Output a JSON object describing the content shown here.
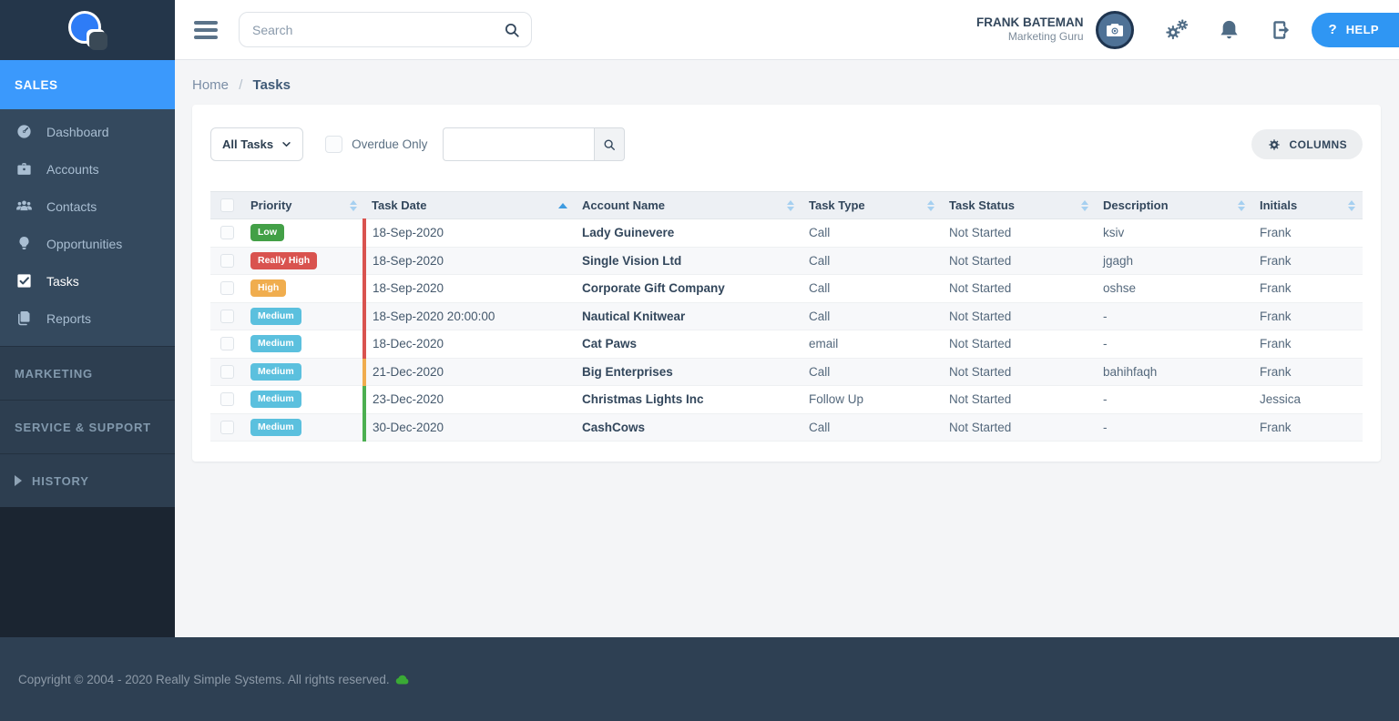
{
  "sidebar": {
    "sales_label": "SALES",
    "items": [
      {
        "label": "Dashboard",
        "icon": "dashboard-icon",
        "active": false
      },
      {
        "label": "Accounts",
        "icon": "accounts-icon",
        "active": false
      },
      {
        "label": "Contacts",
        "icon": "contacts-icon",
        "active": false
      },
      {
        "label": "Opportunities",
        "icon": "opportunities-icon",
        "active": false
      },
      {
        "label": "Tasks",
        "icon": "tasks-icon",
        "active": true
      },
      {
        "label": "Reports",
        "icon": "reports-icon",
        "active": false
      }
    ],
    "sections": [
      "MARKETING",
      "SERVICE & SUPPORT"
    ],
    "history_label": "HISTORY"
  },
  "header": {
    "search_placeholder": "Search",
    "user": {
      "name": "FRANK BATEMAN",
      "role": "Marketing Guru"
    },
    "actions": [
      {
        "icon": "settings-gears-icon"
      },
      {
        "icon": "notifications-bell-icon"
      },
      {
        "icon": "logout-icon"
      }
    ],
    "help_question": "?",
    "help_label": "HELP"
  },
  "breadcrumb": {
    "home": "Home",
    "separator": "/",
    "current": "Tasks"
  },
  "filters": {
    "task_filter_value": "All Tasks",
    "overdue_label": "Overdue Only",
    "search_value": "",
    "columns_label": "COLUMNS"
  },
  "table": {
    "columns": [
      {
        "label": "Priority",
        "sort": "both"
      },
      {
        "label": "Task Date",
        "sort": "asc"
      },
      {
        "label": "Account Name",
        "sort": "both"
      },
      {
        "label": "Task Type",
        "sort": "both"
      },
      {
        "label": "Task Status",
        "sort": "both"
      },
      {
        "label": "Description",
        "sort": "both"
      },
      {
        "label": "Initials",
        "sort": "both"
      }
    ],
    "rows": [
      {
        "priority": "Low",
        "priority_key": "low",
        "date": "18-Sep-2020",
        "flag": "red",
        "account": "Lady Guinevere",
        "type": "Call",
        "status": "Not Started",
        "description": "ksiv",
        "initials": "Frank"
      },
      {
        "priority": "Really High",
        "priority_key": "really_high",
        "date": "18-Sep-2020",
        "flag": "red",
        "account": "Single Vision Ltd",
        "type": "Call",
        "status": "Not Started",
        "description": "jgagh",
        "initials": "Frank"
      },
      {
        "priority": "High",
        "priority_key": "high",
        "date": "18-Sep-2020",
        "flag": "red",
        "account": "Corporate Gift Company",
        "type": "Call",
        "status": "Not Started",
        "description": "oshse",
        "initials": "Frank"
      },
      {
        "priority": "Medium",
        "priority_key": "medium",
        "date": "18-Sep-2020 20:00:00",
        "flag": "red",
        "account": "Nautical Knitwear",
        "type": "Call",
        "status": "Not Started",
        "description": "-",
        "initials": "Frank"
      },
      {
        "priority": "Medium",
        "priority_key": "medium",
        "date": "18-Dec-2020",
        "flag": "red",
        "account": "Cat Paws",
        "type": "email",
        "status": "Not Started",
        "description": "-",
        "initials": "Frank"
      },
      {
        "priority": "Medium",
        "priority_key": "medium",
        "date": "21-Dec-2020",
        "flag": "orange",
        "account": "Big Enterprises",
        "type": "Call",
        "status": "Not Started",
        "description": "bahihfaqh",
        "initials": "Frank"
      },
      {
        "priority": "Medium",
        "priority_key": "medium",
        "date": "23-Dec-2020",
        "flag": "green",
        "account": "Christmas Lights Inc",
        "type": "Follow Up",
        "status": "Not Started",
        "description": "-",
        "initials": "Jessica"
      },
      {
        "priority": "Medium",
        "priority_key": "medium",
        "date": "30-Dec-2020",
        "flag": "green",
        "account": "CashCows",
        "type": "Call",
        "status": "Not Started",
        "description": "-",
        "initials": "Frank"
      }
    ]
  },
  "footer": {
    "copyright": "Copyright © 2004 - 2020 Really Simple Systems. All rights reserved."
  },
  "colors": {
    "accent_blue": "#2f96f3",
    "sales_blue": "#3b99fc",
    "badge": {
      "low": "#43a047",
      "medium": "#5bc0de",
      "high": "#f0ad4e",
      "really_high": "#d9534f"
    },
    "flag": {
      "red": "#d9534f",
      "orange": "#f0ad4e",
      "green": "#4caf50"
    }
  }
}
